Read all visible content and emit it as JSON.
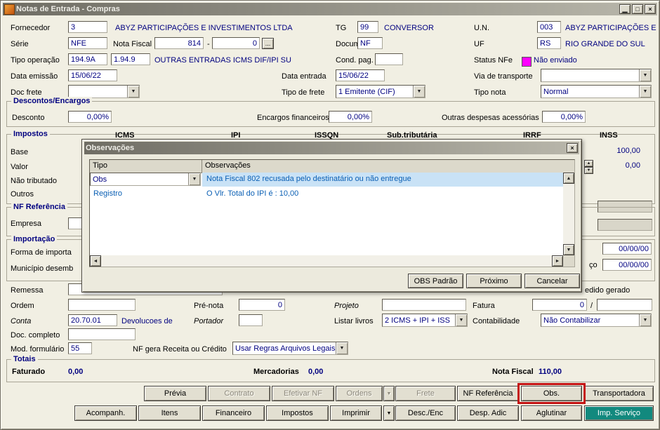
{
  "icons": {
    "minimize": "▁",
    "maximize": "□",
    "close": "×",
    "dropdown": "▼",
    "up": "▲",
    "down": "▼",
    "left": "◄",
    "right": "►",
    "more": "..."
  },
  "window": {
    "title": "Notas de Entrada - Compras"
  },
  "colors": {
    "status_nfe": "#ff00ff",
    "value_text": "#000080",
    "highlight_red": "#c41414",
    "selected_row": "#c9e2f6",
    "teal_button": "#12897e"
  },
  "form": {
    "fornecedor": {
      "label": "Fornecedor",
      "code": "3",
      "name": "ABYZ PARTICIPAÇÕES E INVESTIMENTOS LTDA"
    },
    "tg": {
      "label": "TG",
      "code": "99",
      "name": "CONVERSOR"
    },
    "un": {
      "label": "U.N.",
      "code": "003",
      "name": "ABYZ PARTICIPAÇÕES E"
    },
    "serie": {
      "label": "Série",
      "value": "NFE"
    },
    "nota_fiscal": {
      "label": "Nota Fiscal",
      "num": "814",
      "sep": "-",
      "sub": "0"
    },
    "documento": {
      "label": "Documento",
      "value": "NF"
    },
    "uf": {
      "label": "UF",
      "code": "RS",
      "name": "RIO GRANDE DO SUL"
    },
    "tipo_operacao": {
      "label": "Tipo operação",
      "code1": "194.9A",
      "code2": "1.94.9",
      "desc": "OUTRAS ENTRADAS ICMS DIF/IPI SU"
    },
    "cond_pag": {
      "label": "Cond. pag.",
      "value": ""
    },
    "status_nfe": {
      "label": "Status NFe",
      "value": "Não enviado"
    },
    "data_emissao": {
      "label": "Data emissão",
      "value": "15/06/22"
    },
    "data_entrada": {
      "label": "Data entrada",
      "value": "15/06/22"
    },
    "via_transporte": {
      "label": "Via de transporte",
      "value": ""
    },
    "doc_frete": {
      "label": "Doc frete",
      "value": ""
    },
    "tipo_frete": {
      "label": "Tipo de frete",
      "value": "1 Emitente (CIF)"
    },
    "tipo_nota": {
      "label": "Tipo nota",
      "value": "Normal"
    }
  },
  "descontos": {
    "legend": "Descontos/Encargos",
    "desconto_label": "Desconto",
    "desconto": "0,00%",
    "encargos_label": "Encargos financeiros",
    "encargos": "0,00%",
    "outras_label": "Outras despesas acessórias",
    "outras": "0,00%"
  },
  "impostos": {
    "legend": "Impostos",
    "columns": [
      "ICMS",
      "IPI",
      "ISSQN",
      "Sub.tributária",
      "IRRF",
      "INSS"
    ],
    "row_labels": [
      "Base",
      "Valor",
      "Não tributado",
      "Outros"
    ],
    "visible_values": {
      "base_inss": "100,00",
      "valor_inss": "0,00"
    }
  },
  "nf_referencia": {
    "legend": "NF Referência",
    "empresa_label": "Empresa"
  },
  "importacao": {
    "legend": "Importação",
    "forma_label": "Forma de importa",
    "municipio_label": "Município desemb",
    "data1": "00/00/00",
    "frag_label": "ço",
    "data2": "00/00/00"
  },
  "remessa": {
    "label": "Remessa",
    "pedido_frag": "edido gerado"
  },
  "detalhes": {
    "ordem_label": "Ordem",
    "ordem": "",
    "pre_nota_label": "Pré-nota",
    "pre_nota": "0",
    "projeto_label": "Projeto",
    "projeto": "",
    "fatura_label": "Fatura",
    "fatura": "0",
    "fatura_sep": "/",
    "fatura2": "",
    "conta_label": "Conta",
    "conta": "20.70.01",
    "conta_desc": "Devolucoes de",
    "portador_label": "Portador",
    "portador": "",
    "listar_label": "Listar livros",
    "listar": "2 ICMS + IPI + ISS",
    "contab_label": "Contabilidade",
    "contab": "Não Contabilizar",
    "doc_completo_label": "Doc. completo",
    "doc_completo": "",
    "mod_form_label": "Mod. formulário",
    "mod_form": "55",
    "nf_gera_label": "NF gera Receita ou Crédito",
    "nf_gera": "Usar Regras Arquivos Legais"
  },
  "totais": {
    "legend": "Totais",
    "faturado_label": "Faturado",
    "faturado": "0,00",
    "mercadorias_label": "Mercadorias",
    "mercadorias": "0,00",
    "nota_fiscal_label": "Nota Fiscal",
    "nota_fiscal": "110,00"
  },
  "actions_row1": [
    "Prévia",
    "Contrato",
    "Efetivar NF",
    "Ordens",
    "Frete",
    "NF Referência",
    "Obs.",
    "Transportadora"
  ],
  "actions_row2": [
    "Acompanh.",
    "Itens",
    "Financeiro",
    "Impostos",
    "Imprimir",
    "Desc./Enc",
    "Desp. Adic",
    "Aglutinar",
    "Imp. Serviço"
  ],
  "modal": {
    "title": "Observações",
    "columns": [
      "Tipo",
      "Observações"
    ],
    "rows": [
      {
        "tipo": "Obs",
        "text": "Nota Fiscal 802 recusada pelo destinatário ou não entregue"
      },
      {
        "tipo": "Registro",
        "text": "O Vlr. Total do IPI é : 10,00"
      }
    ],
    "buttons": [
      "OBS Padrão",
      "Próximo",
      "Cancelar"
    ]
  }
}
